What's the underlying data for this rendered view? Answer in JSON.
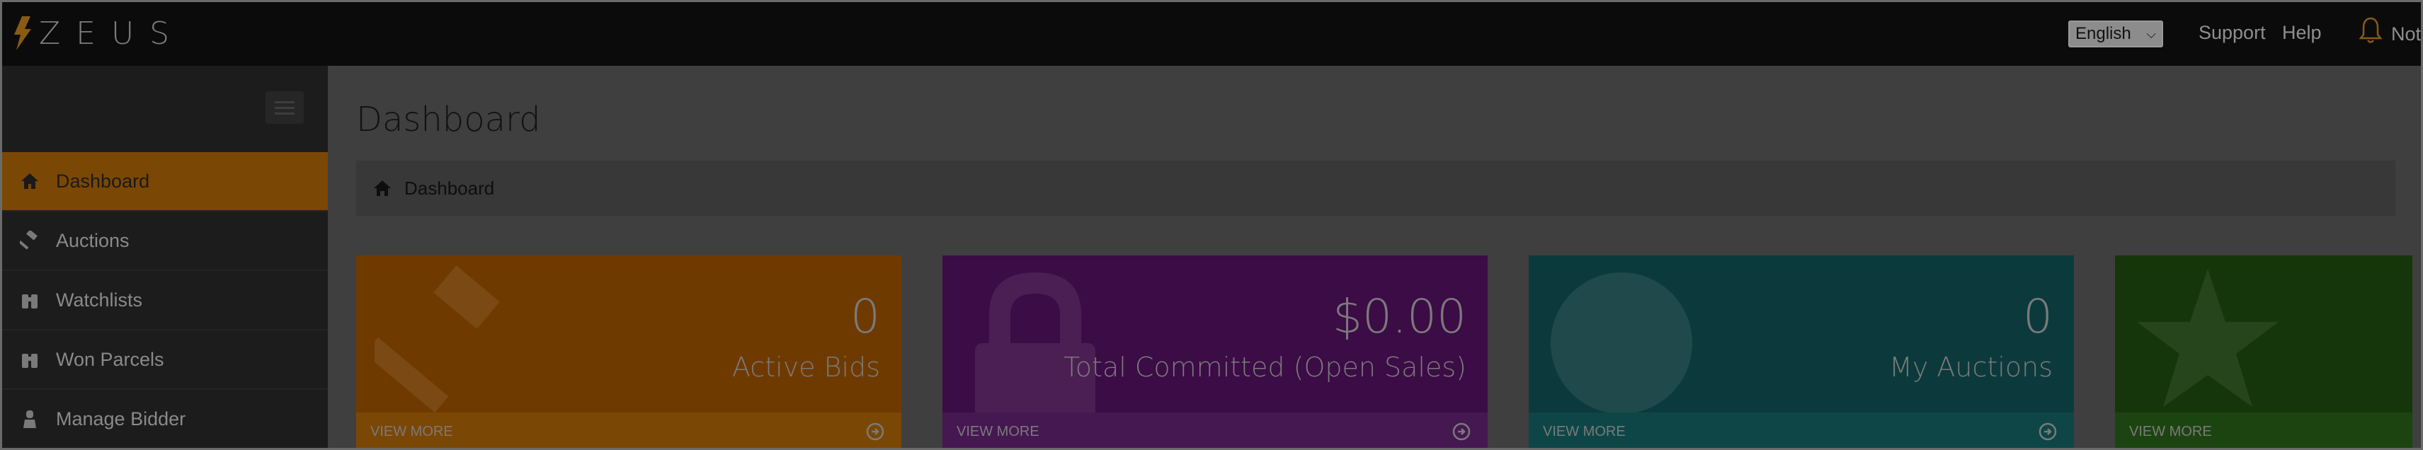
{
  "app": {
    "name": "ZEUS"
  },
  "topbar": {
    "language": "English",
    "support": "Support",
    "help": "Help",
    "notifications": "Noti"
  },
  "sidebar": {
    "items": [
      {
        "label": "Dashboard",
        "icon": "home-icon",
        "active": true
      },
      {
        "label": "Auctions",
        "icon": "gavel-icon",
        "active": false
      },
      {
        "label": "Watchlists",
        "icon": "binoculars-icon",
        "active": false
      },
      {
        "label": "Won Parcels",
        "icon": "binoculars-icon",
        "active": false
      },
      {
        "label": "Manage Bidder",
        "icon": "user-icon",
        "active": false
      }
    ]
  },
  "main": {
    "title": "Dashboard",
    "breadcrumb": "Dashboard",
    "cards": [
      {
        "value": "0",
        "label": "Active Bids",
        "footer": "VIEW MORE",
        "color": "#f28a0c",
        "icon": "gavel-icon"
      },
      {
        "value": "$0.00",
        "label": "Total Committed (Open Sales)",
        "footer": "VIEW MORE",
        "color": "#8a1ca0",
        "icon": "lock-icon"
      },
      {
        "value": "0",
        "label": "My Auctions",
        "footer": "VIEW MORE",
        "color": "#1a9ea3",
        "icon": "globe-icon"
      },
      {
        "value": "",
        "label": "",
        "footer": "VIEW MORE",
        "color": "#2f8a18",
        "icon": "star-icon"
      }
    ]
  }
}
